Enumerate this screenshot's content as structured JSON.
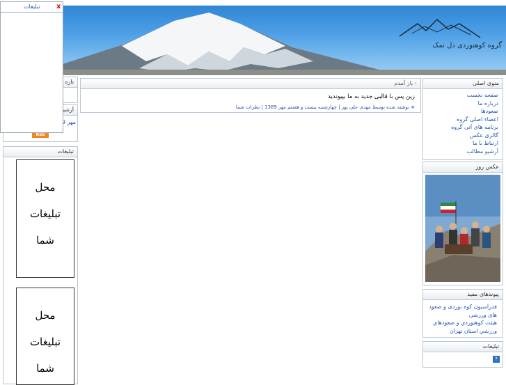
{
  "header": {
    "site_name": "گروه کوهنوردی دل نمک",
    "logo_script": "دل نمک"
  },
  "main_menu": {
    "title": "منوی اصلی",
    "items": [
      "صفحه نخست",
      "درباره ما",
      "صعودها",
      "اعضاء اصلی گروه",
      "برنامه های آتی گروه",
      "گالری عکس",
      "ارتباط با ما",
      "آرشیو مطالب"
    ]
  },
  "photo_of_day": {
    "title": "عکس روز"
  },
  "useful_links": {
    "title": "پیوندهای مفید",
    "items": [
      "فدراسیون کوه نوردی و صعود های ورزشی",
      "هیئت کوهنوردي و صعودهاي ورزشي استان تهران"
    ]
  },
  "right_ads": {
    "title": "تبلیغات",
    "icon": "question-image-icon"
  },
  "post": {
    "title": "باز آمدم",
    "body": "زین پس با قالبی جدید به ما بپیوندید",
    "footer": "نوشته شده توسط مهدی علی پور | چهارشنبه بیست و هشتم مهر 1389 | نظرات شما"
  },
  "left_panel": {
    "recent_title_partial": "تازه ه",
    "archive_title_partial": "آرشیو",
    "archive_item_partial": "مهر 9",
    "rss": "RSS"
  },
  "left_ads": {
    "title": "تبلیغات",
    "card_lines": [
      "محل",
      "تبلیغات",
      "شما"
    ]
  },
  "float_ad": {
    "title": "تبلیغات",
    "close": "x"
  }
}
